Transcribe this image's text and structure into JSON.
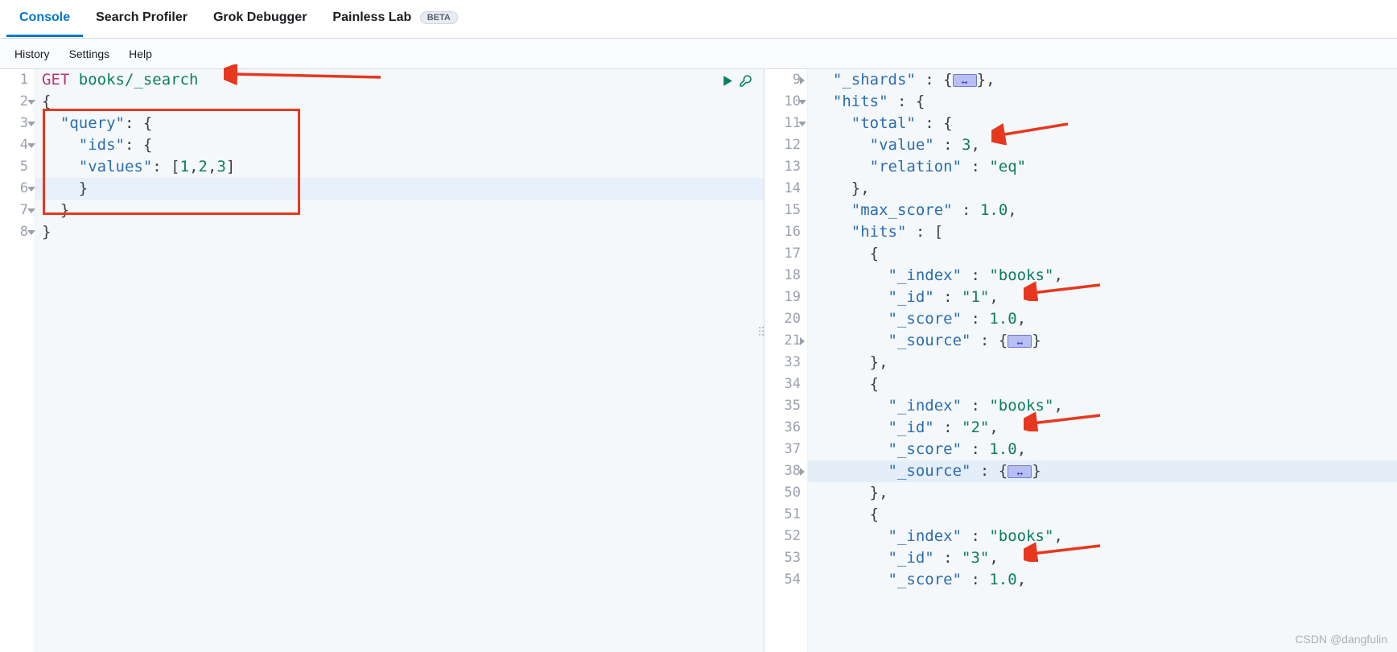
{
  "tabs": {
    "console": "Console",
    "search_profiler": "Search Profiler",
    "grok_debugger": "Grok Debugger",
    "painless_lab": "Painless Lab",
    "beta": "BETA"
  },
  "subbar": {
    "history": "History",
    "settings": "Settings",
    "help": "Help"
  },
  "watermark": "CSDN @dangfulin",
  "request": {
    "method": "GET",
    "path": "books/_search",
    "line_numbers": [
      1,
      2,
      3,
      4,
      5,
      6,
      7,
      8
    ],
    "body_tokens": {
      "open": "{",
      "query_key": "\"query\"",
      "ids_key": "\"ids\"",
      "values_key": "\"values\"",
      "values_arr": "[",
      "v1": "1",
      "v2": "2",
      "v3": "3",
      "arr_close": "]",
      "close_brace": "}",
      "colon_open": ": {",
      "comma": ","
    }
  },
  "response": {
    "line_numbers": [
      9,
      10,
      11,
      12,
      13,
      14,
      15,
      16,
      17,
      18,
      19,
      20,
      21,
      33,
      34,
      35,
      36,
      37,
      38,
      50,
      51,
      52,
      53,
      54
    ],
    "fold_at": [
      21,
      38
    ],
    "tokens": {
      "shards": "\"_shards\"",
      "hits": "\"hits\"",
      "total": "\"total\"",
      "value": "\"value\"",
      "relation": "\"relation\"",
      "max_score": "\"max_score\"",
      "index": "\"_index\"",
      "id": "\"_id\"",
      "score": "\"_score\"",
      "source": "\"_source\"",
      "eq": "\"eq\"",
      "books": "\"books\"",
      "id1": "\"1\"",
      "id2": "\"2\"",
      "id3": "\"3\"",
      "n3": "3",
      "n1_0": "1.0",
      "open": "{",
      "close": "}",
      "comma": ",",
      "colon": " : ",
      "arr_open": "[",
      "close_comma": "},"
    }
  }
}
